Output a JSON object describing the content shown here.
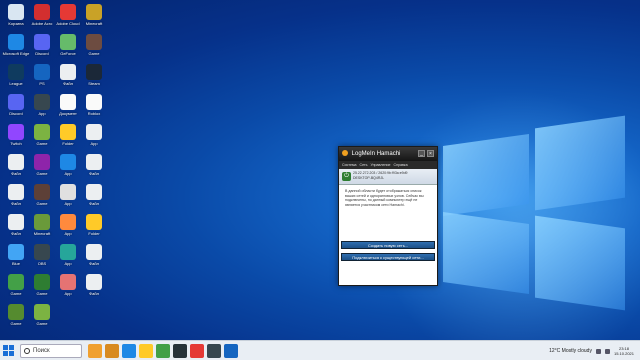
{
  "desktop": {
    "icons": [
      {
        "label": "Корзина",
        "color": "#d9e6f2"
      },
      {
        "label": "Adobe Acro",
        "color": "#d32f2f"
      },
      {
        "label": "Adobe Cloud",
        "color": "#e53935"
      },
      {
        "label": "Minecraft",
        "color": "#c9a227"
      },
      {
        "label": "Microsoft Edge",
        "color": "#1e88e5"
      },
      {
        "label": "Discord",
        "color": "#5865f2"
      },
      {
        "label": "GeForce",
        "color": "#66bb6a"
      },
      {
        "label": "Game",
        "color": "#6d4c41"
      },
      {
        "label": "League",
        "color": "#0f3b5f"
      },
      {
        "label": "PS",
        "color": "#1565c0"
      },
      {
        "label": "Файл",
        "color": "#eceff1"
      },
      {
        "label": "Steam",
        "color": "#1b2838"
      },
      {
        "label": "Discord",
        "color": "#5865f2"
      },
      {
        "label": "App",
        "color": "#37474f"
      },
      {
        "label": "Документ",
        "color": "#fafafa"
      },
      {
        "label": "Roblox",
        "color": "#fafafa"
      },
      {
        "label": "Twitch",
        "color": "#9146ff"
      },
      {
        "label": "Game",
        "color": "#7cb342"
      },
      {
        "label": "Folder",
        "color": "#ffca28"
      },
      {
        "label": "App",
        "color": "#eceff1"
      },
      {
        "label": "Файл",
        "color": "#eceff1"
      },
      {
        "label": "Game",
        "color": "#8e24aa"
      },
      {
        "label": "App",
        "color": "#1e88e5"
      },
      {
        "label": "Файл",
        "color": "#eceff1"
      },
      {
        "label": "Файл",
        "color": "#eceff1"
      },
      {
        "label": "Game",
        "color": "#5d4037"
      },
      {
        "label": "App",
        "color": "#e0e0e0"
      },
      {
        "label": "Файл",
        "color": "#eceff1"
      },
      {
        "label": "Файл",
        "color": "#eceff1"
      },
      {
        "label": "Minecraft",
        "color": "#6a9a3a"
      },
      {
        "label": "App",
        "color": "#ff8a3d"
      },
      {
        "label": "Folder",
        "color": "#ffca28"
      },
      {
        "label": "Blue",
        "color": "#42a5f5"
      },
      {
        "label": "OBS",
        "color": "#37474f"
      },
      {
        "label": "App",
        "color": "#26a69a"
      },
      {
        "label": "Файл",
        "color": "#eceff1"
      },
      {
        "label": "Game",
        "color": "#43a047"
      },
      {
        "label": "Game",
        "color": "#2e7d32"
      },
      {
        "label": "App",
        "color": "#e57373"
      },
      {
        "label": "Файл",
        "color": "#eceff1"
      },
      {
        "label": "Game",
        "color": "#558b2f"
      },
      {
        "label": "Game",
        "color": "#7cb342"
      }
    ]
  },
  "hamachi": {
    "title": "LogMeIn Hamachi",
    "menu": [
      "Система",
      "Сеть",
      "Управление",
      "Справка"
    ],
    "status_line1": "25.22.272.203 / 2620:9b:f93a:e9d9",
    "status_line2": "DESKTOP-BQ4RJL",
    "body_text": "В данной области будет отображаться список ваших сетей и одноранговых узлов. Сейчас вы подключены, но данный компьютер ещё не является участником сети Hamachi.",
    "create_button": "Создать новую сеть...",
    "join_button": "Подключиться к существующей сети..."
  },
  "taskbar": {
    "search_placeholder": "Поиск",
    "weather": "12°C  Mostly cloudy",
    "time": "23:18",
    "date": "15.10.2021",
    "apps": [
      {
        "name": "monkey-app",
        "color": "#f0a030"
      },
      {
        "name": "monkey-app-2",
        "color": "#d88a20"
      },
      {
        "name": "edge",
        "color": "#1e88e5"
      },
      {
        "name": "explorer",
        "color": "#ffca28"
      },
      {
        "name": "green-app",
        "color": "#43a047"
      },
      {
        "name": "dark-app",
        "color": "#263238"
      },
      {
        "name": "red-app",
        "color": "#e53935"
      },
      {
        "name": "dark-app-2",
        "color": "#37474f"
      },
      {
        "name": "hamachi",
        "color": "#1565c0"
      }
    ]
  }
}
